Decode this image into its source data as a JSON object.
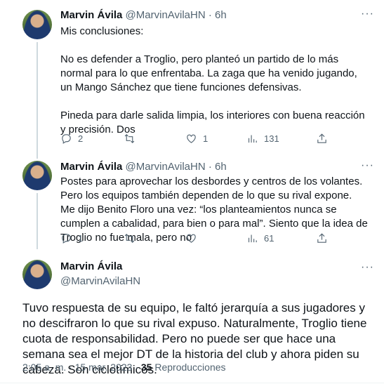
{
  "tweets": [
    {
      "name": "Marvin Ávila",
      "handle": "@MarvinAvilaHN",
      "sep": "·",
      "time": "6h",
      "text": "Mis conclusiones:\n\nNo es defender a Troglio, pero planteó un partido de lo más normal para lo que enfrentaba. La zaga que ha venido jugando, un Mango Sánchez que tiene funciones defensivas.\n\nPineda para darle salida limpia, los interiores con buena reacción y precisión. Dos",
      "replies": "2",
      "retweets": "",
      "likes": "1",
      "views": "131"
    },
    {
      "name": "Marvin Ávila",
      "handle": "@MarvinAvilaHN",
      "sep": "·",
      "time": "6h",
      "text": "Postes para aprovechar los desbordes y centros de los volantes. Pero los equipos también dependen de lo que su rival expone. Me dijo Benito Floro una vez: “los planteamientos nunca se cumplen a cabalidad, para bien o para mal”. Siento que la idea de Troglio no fue mala, pero no",
      "replies": "1",
      "retweets": "",
      "likes": "",
      "views": "61"
    }
  ],
  "main": {
    "name": "Marvin Ávila",
    "handle": "@MarvinAvilaHN",
    "text": "Tuvo respuesta de su equipo, le faltó jerarquía a sus jugadores y no descifraron lo que su rival expuso. Naturalmente, Troglio tiene cuota de responsabilidad. Pero no puede ser que hace una semana sea el mejor DT de la historia del club y ahora piden su cabeza. Son ciclotímicos.",
    "timestamp": "2:05 a. m. · 15 mar. 2023",
    "sep": "·",
    "views_count": "35",
    "views_label": "Reproducciones"
  },
  "icons": {
    "more": "more-dots-icon",
    "reply": "reply-icon",
    "retweet": "retweet-icon",
    "like": "heart-icon",
    "views": "views-chart-icon",
    "share": "share-icon"
  },
  "more_glyph": "···"
}
